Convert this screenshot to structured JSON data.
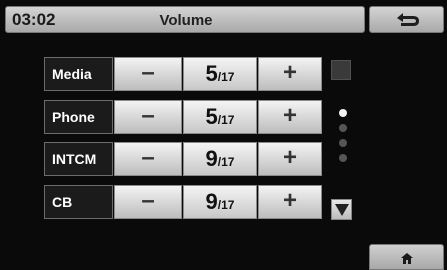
{
  "header": {
    "time": "03:02",
    "title": "Volume",
    "back_icon": "back-arrow-icon"
  },
  "controls": {
    "minus_label": "–",
    "plus_label": "+",
    "max_suffix": "/17"
  },
  "volume_rows": [
    {
      "label": "Media",
      "value": "5"
    },
    {
      "label": "Phone",
      "value": "5"
    },
    {
      "label": "INTCM",
      "value": "9"
    },
    {
      "label": "CB",
      "value": "9"
    }
  ],
  "pager": {
    "page_count": 4,
    "current_page": 1,
    "up_icon": "scroll-up-icon",
    "down_icon": "scroll-down-icon"
  },
  "footer": {
    "home_icon": "home-icon"
  }
}
